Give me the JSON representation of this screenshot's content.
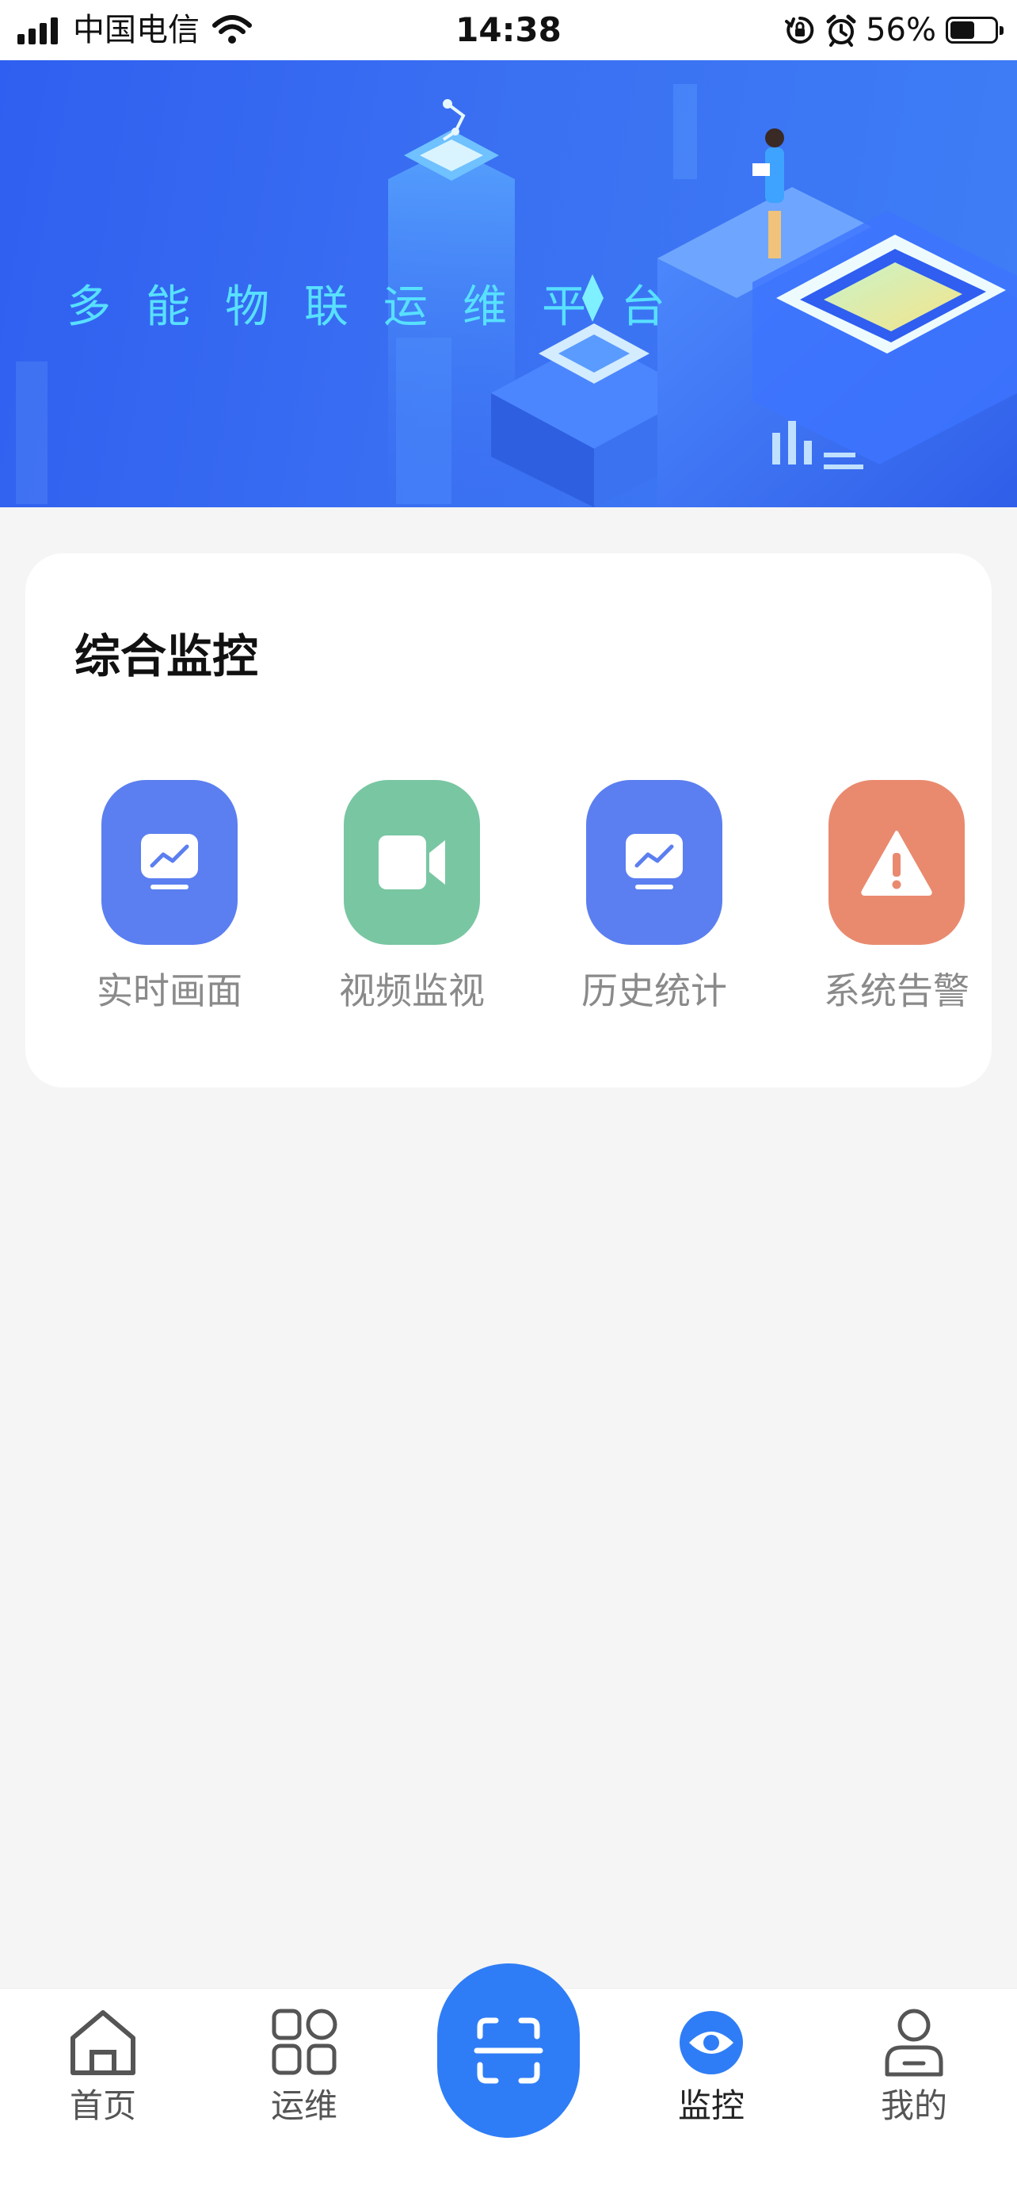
{
  "status_bar": {
    "carrier": "中国电信",
    "time": "14:38",
    "battery": "56%",
    "battery_level": 0.56
  },
  "banner": {
    "title": "多能物联运维平台"
  },
  "monitor": {
    "title": "综合监控",
    "items": [
      {
        "label": "实时画面",
        "icon": "monitor-chart-icon",
        "color": "#5b7ff0"
      },
      {
        "label": "视频监视",
        "icon": "video-camera-icon",
        "color": "#79c6a3"
      },
      {
        "label": "历史统计",
        "icon": "monitor-chart-icon",
        "color": "#5b7ff0"
      },
      {
        "label": "系统告警",
        "icon": "warning-icon",
        "color": "#e98a6f"
      }
    ]
  },
  "tabbar": {
    "items": [
      {
        "label": "首页",
        "icon": "home-icon"
      },
      {
        "label": "运维",
        "icon": "grid-icon"
      },
      {
        "label": "",
        "icon": "scan-icon"
      },
      {
        "label": "监控",
        "icon": "eye-icon",
        "active": true
      },
      {
        "label": "我的",
        "icon": "user-icon"
      }
    ],
    "accent": "#2f7df6"
  }
}
